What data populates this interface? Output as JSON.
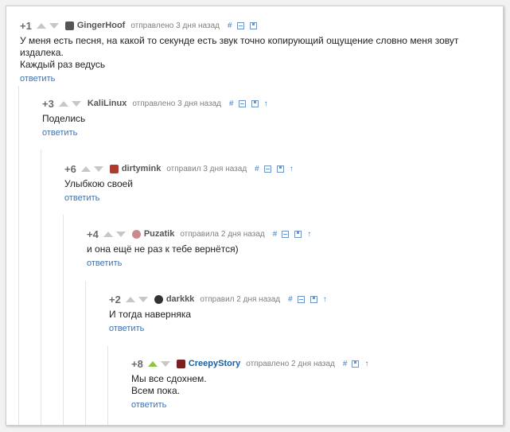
{
  "comments": [
    {
      "rating": "+1",
      "author": "GingerHoof",
      "meta": "отправлено 3 дня назад",
      "tools": [
        "#",
        "⊟",
        "🖫"
      ],
      "lines": [
        "У меня есть песня, на какой то секунде есть звук точно копирующий ощущение словно меня зовут издалека.",
        "Каждый раз ведусь"
      ],
      "reply": "ответить",
      "avatar_color": "#555555",
      "avatar_icon": "ginger-avatar-icon"
    },
    {
      "rating": "+3",
      "author": "KaliLinux",
      "meta": "отправлено 3 дня назад",
      "tools": [
        "#",
        "⊟",
        "🖫",
        "↑"
      ],
      "lines": [
        "Поделись"
      ],
      "reply": "ответить",
      "avatar_color": "",
      "avatar_icon": ""
    },
    {
      "rating": "+6",
      "author": "dirtymink",
      "meta": "отправил 3 дня назад",
      "tools": [
        "#",
        "⊟",
        "🖫",
        "↑"
      ],
      "lines": [
        "Улыбкою своей"
      ],
      "reply": "ответить",
      "avatar_color": "#b03a2e",
      "avatar_icon": "mink-avatar-icon"
    },
    {
      "rating": "+4",
      "author": "Puzatik",
      "meta": "отправила 2 дня назад",
      "tools": [
        "#",
        "⊟",
        "🖫",
        "↑"
      ],
      "lines": [
        "и она ещё не раз к тебе вернётся)"
      ],
      "reply": "ответить",
      "avatar_color": "#c98a8a",
      "avatar_icon": "puzatik-avatar-icon"
    },
    {
      "rating": "+2",
      "author": "darkkk",
      "meta": "отправил 2 дня назад",
      "tools": [
        "#",
        "⊟",
        "🖫",
        "↑"
      ],
      "lines": [
        "И тогда наверняка"
      ],
      "reply": "ответить",
      "avatar_color": "#333333",
      "avatar_icon": "darkkk-avatar-icon"
    },
    {
      "rating": "+8",
      "author": "CreepyStory",
      "meta": "отправлено 2 дня назад",
      "tools": [
        "#",
        "🖫",
        "↑"
      ],
      "lines": [
        "Мы все сдохнем.",
        "Всем пока."
      ],
      "reply": "ответить",
      "avatar_color": "#7a1f1f",
      "avatar_icon": "creepystory-avatar-icon"
    }
  ]
}
